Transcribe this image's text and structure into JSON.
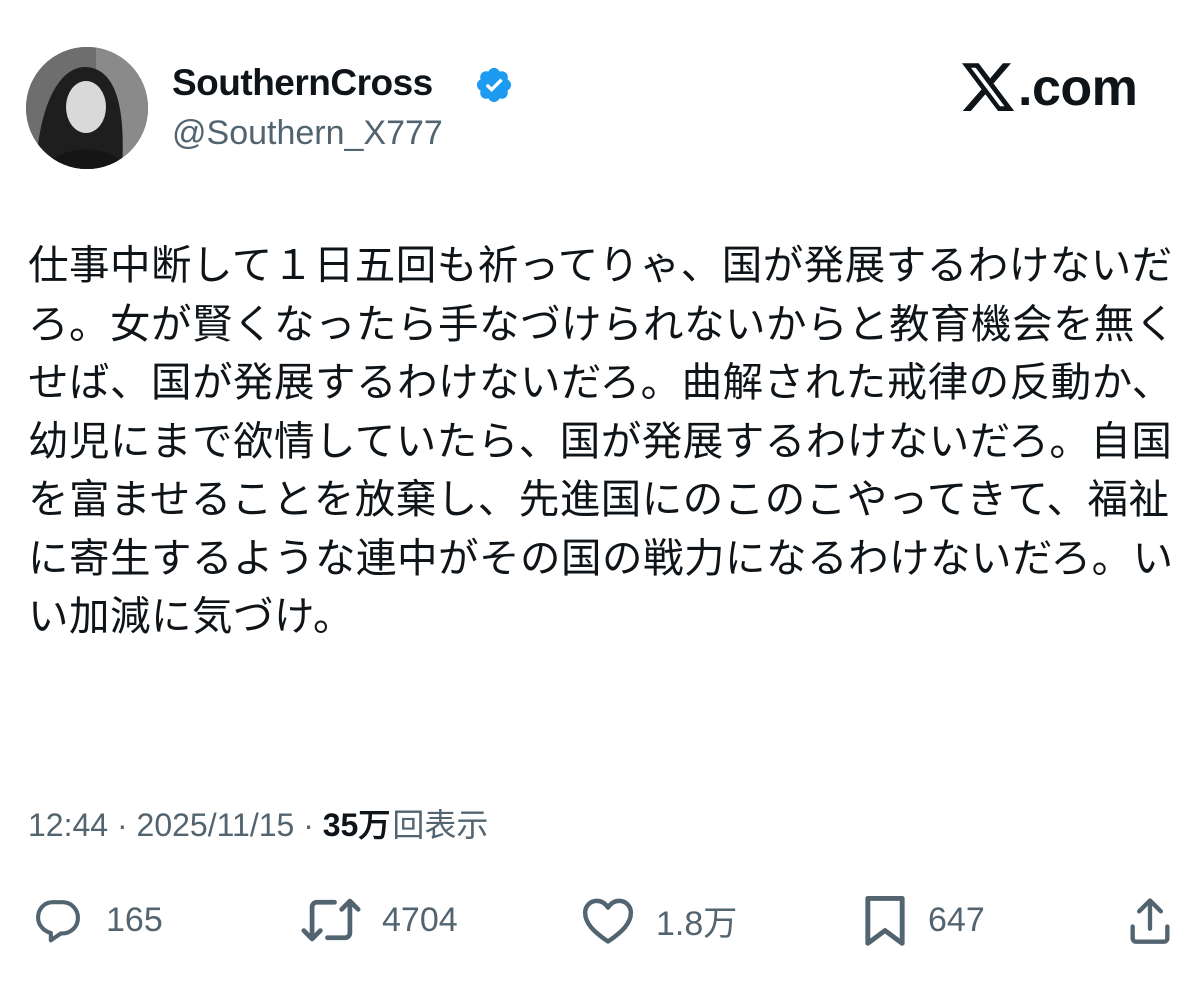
{
  "author": {
    "display_name": "SouthernCross",
    "handle": "@Southern_X777",
    "verified": true,
    "verified_color": "#1d9bf0"
  },
  "brand": {
    "text": ".com",
    "icon": "x-logo-icon"
  },
  "tweet": {
    "text": "仕事中断して１日五回も祈ってりゃ、国が発展するわけないだろ。女が賢くなったら手なづけられないからと教育機会を無くせば、国が発展するわけないだろ。曲解された戒律の反動か、幼児にまで欲情していたら、国が発展するわけないだろ。自国を富ませることを放棄し、先進国にのこのこやってきて、福祉に寄生するような連中がその国の戦力になるわけないだろ。いい加減に気づけ。"
  },
  "meta": {
    "time": "12:44",
    "separator": " · ",
    "date": "2025/11/15",
    "views_count": "35万",
    "views_label": "回表示"
  },
  "actions": {
    "replies": {
      "icon": "reply-icon",
      "count": "165"
    },
    "reposts": {
      "icon": "repost-icon",
      "count": "4704"
    },
    "likes": {
      "icon": "like-icon",
      "count": "1.8万"
    },
    "bookmarks": {
      "icon": "bookmark-icon",
      "count": "647"
    },
    "share": {
      "icon": "share-icon"
    }
  },
  "colors": {
    "text": "#0f1419",
    "secondary": "#536471",
    "background": "#ffffff"
  }
}
